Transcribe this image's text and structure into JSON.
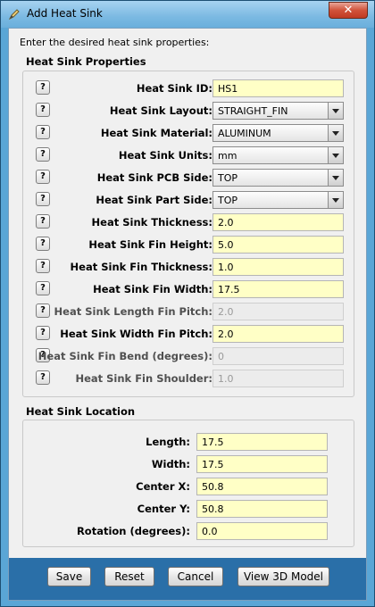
{
  "window": {
    "title": "Add Heat Sink",
    "close_glyph": "✕"
  },
  "intro": "Enter the desired heat sink properties:",
  "properties": {
    "title": "Heat Sink Properties",
    "help_glyph": "?",
    "rows": [
      {
        "label": "Heat Sink ID:",
        "type": "text",
        "value": "HS1",
        "enabled": true
      },
      {
        "label": "Heat Sink Layout:",
        "type": "select",
        "value": "STRAIGHT_FIN",
        "enabled": true
      },
      {
        "label": "Heat Sink Material:",
        "type": "select",
        "value": "ALUMINUM",
        "enabled": true
      },
      {
        "label": "Heat Sink Units:",
        "type": "select",
        "value": "mm",
        "enabled": true
      },
      {
        "label": "Heat Sink PCB Side:",
        "type": "select",
        "value": "TOP",
        "enabled": true
      },
      {
        "label": "Heat Sink Part Side:",
        "type": "select",
        "value": "TOP",
        "enabled": true
      },
      {
        "label": "Heat Sink Thickness:",
        "type": "text",
        "value": "2.0",
        "enabled": true
      },
      {
        "label": "Heat Sink Fin Height:",
        "type": "text",
        "value": "5.0",
        "enabled": true
      },
      {
        "label": "Heat Sink Fin Thickness:",
        "type": "text",
        "value": "1.0",
        "enabled": true
      },
      {
        "label": "Heat Sink Fin Width:",
        "type": "text",
        "value": "17.5",
        "enabled": true
      },
      {
        "label": "Heat Sink Length Fin Pitch:",
        "type": "text",
        "value": "2.0",
        "enabled": false
      },
      {
        "label": "Heat Sink Width Fin Pitch:",
        "type": "text",
        "value": "2.0",
        "enabled": true
      },
      {
        "label": "Heat Sink Fin Bend (degrees):",
        "type": "text",
        "value": "0",
        "enabled": false
      },
      {
        "label": "Heat Sink Fin Shoulder:",
        "type": "text",
        "value": "1.0",
        "enabled": false
      }
    ]
  },
  "location": {
    "title": "Heat Sink Location",
    "rows": [
      {
        "label": "Length:",
        "value": "17.5"
      },
      {
        "label": "Width:",
        "value": "17.5"
      },
      {
        "label": "Center X:",
        "value": "50.8"
      },
      {
        "label": "Center Y:",
        "value": "50.8"
      },
      {
        "label": "Rotation (degrees):",
        "value": "0.0"
      }
    ]
  },
  "buttons": {
    "save": "Save",
    "reset": "Reset",
    "cancel": "Cancel",
    "view3d": "View 3D Model"
  },
  "colors": {
    "input_bg": "#ffffc6",
    "footer_bg": "#2a6fa8",
    "titlebar": "#7bb9e2"
  },
  "icons": {
    "app": "pencil-icon",
    "close": "close-icon",
    "help": "help-icon",
    "dropdown": "chevron-down-icon"
  }
}
